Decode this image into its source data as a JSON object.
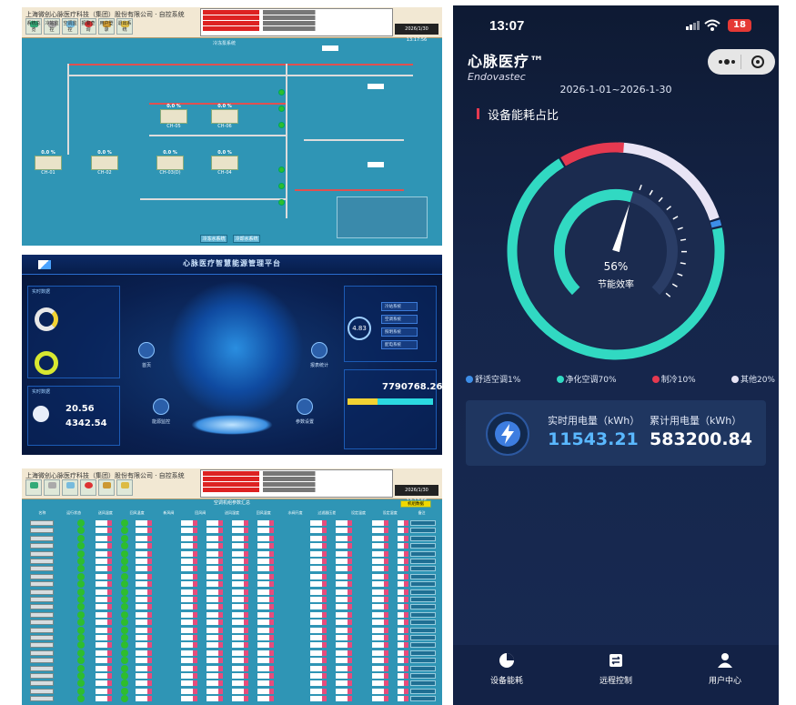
{
  "scada": {
    "title": "上海微创心脉医疗科技（集团）股份有限公司 · 自控系统",
    "toolbar": [
      "系统总览",
      "冷站监控",
      "空调监控",
      "报警查询",
      "用户登录",
      "退出系统"
    ],
    "section_label": "冷冻泵系统",
    "datetime": "2026/1/30 13:17:56",
    "chillers": [
      {
        "tag": "CH-01",
        "value": "0.0 %"
      },
      {
        "tag": "CH-02",
        "value": "0.0 %"
      },
      {
        "tag": "CH-03(D)",
        "value": "0.0 %"
      },
      {
        "tag": "CH-04",
        "value": "0.0 %"
      },
      {
        "tag": "CH-05",
        "value": "0.0 %"
      },
      {
        "tag": "CH-06",
        "value": "0.0 %"
      }
    ],
    "bottom_buttons": [
      "冷冻水系统",
      "冷却水系统"
    ]
  },
  "dashboard": {
    "title": "心脉医疗智慧能源管理平台",
    "left_title": "实时数据",
    "energy_label": "实时数据",
    "big_value": "20.56",
    "big_value2": "4342.54",
    "total_value": "7790768.26",
    "gauge_value": "4.83",
    "side_labels": [
      "首页",
      "能源监控",
      "报表统计",
      "参数设置"
    ],
    "menu": [
      "冷站系统",
      "空调系统",
      "照明系统",
      "配电系统"
    ],
    "colors": {
      "accent": "#2a8ee0",
      "panel": "#0a2050"
    }
  },
  "pumps": {
    "title": "上海微创心脉医疗科技（集团）股份有限公司 · 自控系统",
    "table_title": "空调机组参数汇总",
    "action_button": "机组数据",
    "columns": [
      "名称",
      "运行状态",
      "送风温度",
      "回风温度",
      "新风阀",
      "回风阀",
      "送风湿度",
      "回风湿度",
      "水阀开度",
      "过滤器压差",
      "设定温度",
      "设定湿度",
      "备注"
    ]
  },
  "mobile": {
    "status_time": "13:07",
    "battery": "18",
    "brand_cn": "心脉医疗™",
    "brand_en": "Endovastec",
    "date_range": "2026-1-01~2026-1-30",
    "section_title": "设备能耗占比",
    "efficiency_pct": "56%",
    "efficiency_label": "节能效率",
    "efficiency_value": 0.56,
    "legend": [
      {
        "label": "舒适空调1%",
        "color": "#3d8ee8",
        "share": 0.01
      },
      {
        "label": "净化空调70%",
        "color": "#31d9c2",
        "share": 0.7
      },
      {
        "label": "制冷10%",
        "color": "#e53950",
        "share": 0.1
      },
      {
        "label": "其他20%",
        "color": "#e8e4f5",
        "share": 0.2
      }
    ],
    "realtime_label": "实时用电量（kWh）",
    "realtime_value": "11543.21",
    "total_label": "累计用电量（kWh）",
    "total_value": "583200.84",
    "tabs": [
      {
        "label": "设备能耗",
        "icon": "pie-chart-icon"
      },
      {
        "label": "远程控制",
        "icon": "control-icon"
      },
      {
        "label": "用户中心",
        "icon": "user-icon"
      }
    ],
    "colors": {
      "realtime": "#5ab8ff",
      "total": "#ffffff",
      "accent": "#e53950"
    }
  }
}
